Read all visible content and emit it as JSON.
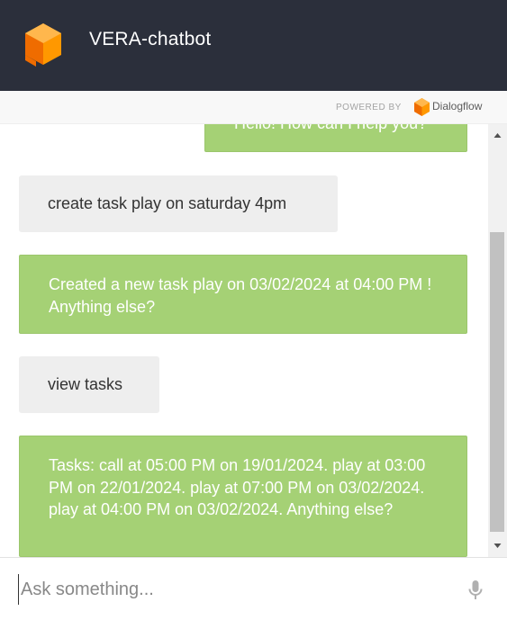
{
  "header": {
    "title": "VERA-chatbot",
    "logo_icon": "dialogflow-cube-icon",
    "background": "#2b2f3b"
  },
  "powered_by": {
    "label": "POWERED BY",
    "brand": "Dialogflow",
    "brand_icon": "dialogflow-logo-icon"
  },
  "messages": [
    {
      "role": "bot",
      "text": "Hello! How can I help you?"
    },
    {
      "role": "user",
      "text": "create task play on saturday 4pm"
    },
    {
      "role": "bot",
      "text": "Created a new task play on 03/02/2024 at 04:00 PM ! Anything else?"
    },
    {
      "role": "user",
      "text": "view tasks"
    },
    {
      "role": "bot",
      "text": "Tasks: call at 05:00 PM on 19/01/2024. play at 03:00 PM on 22/01/2024. play at 07:00 PM on 03/02/2024. play at 04:00 PM on 03/02/2024. Anything else?"
    }
  ],
  "colors": {
    "bot_bubble": "#a5d175",
    "user_bubble": "#eeeeee"
  },
  "input": {
    "placeholder": "Ask something...",
    "value": "",
    "mic_icon": "microphone-icon"
  }
}
